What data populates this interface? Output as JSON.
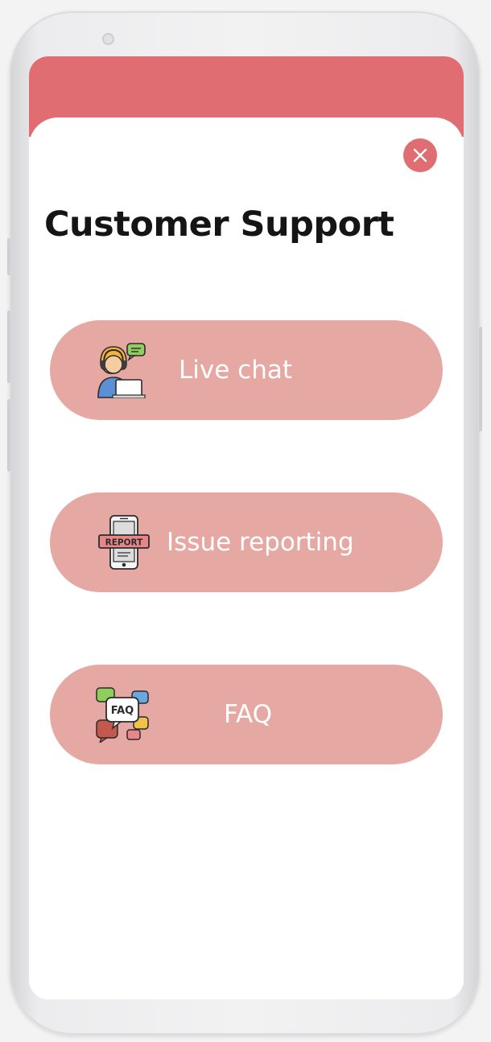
{
  "page": {
    "title": "Customer Support"
  },
  "close": {
    "icon": "close-icon"
  },
  "options": [
    {
      "label": "Live chat",
      "icon": "support-agent-icon"
    },
    {
      "label": "Issue reporting",
      "icon": "report-phone-icon",
      "icon_text": "REPORT"
    },
    {
      "label": "FAQ",
      "icon": "faq-bubbles-icon",
      "icon_text": "FAQ"
    }
  ],
  "colors": {
    "accent": "#e06d72",
    "button": "#e5a8a2",
    "title": "#151515",
    "label": "#ffffff"
  }
}
